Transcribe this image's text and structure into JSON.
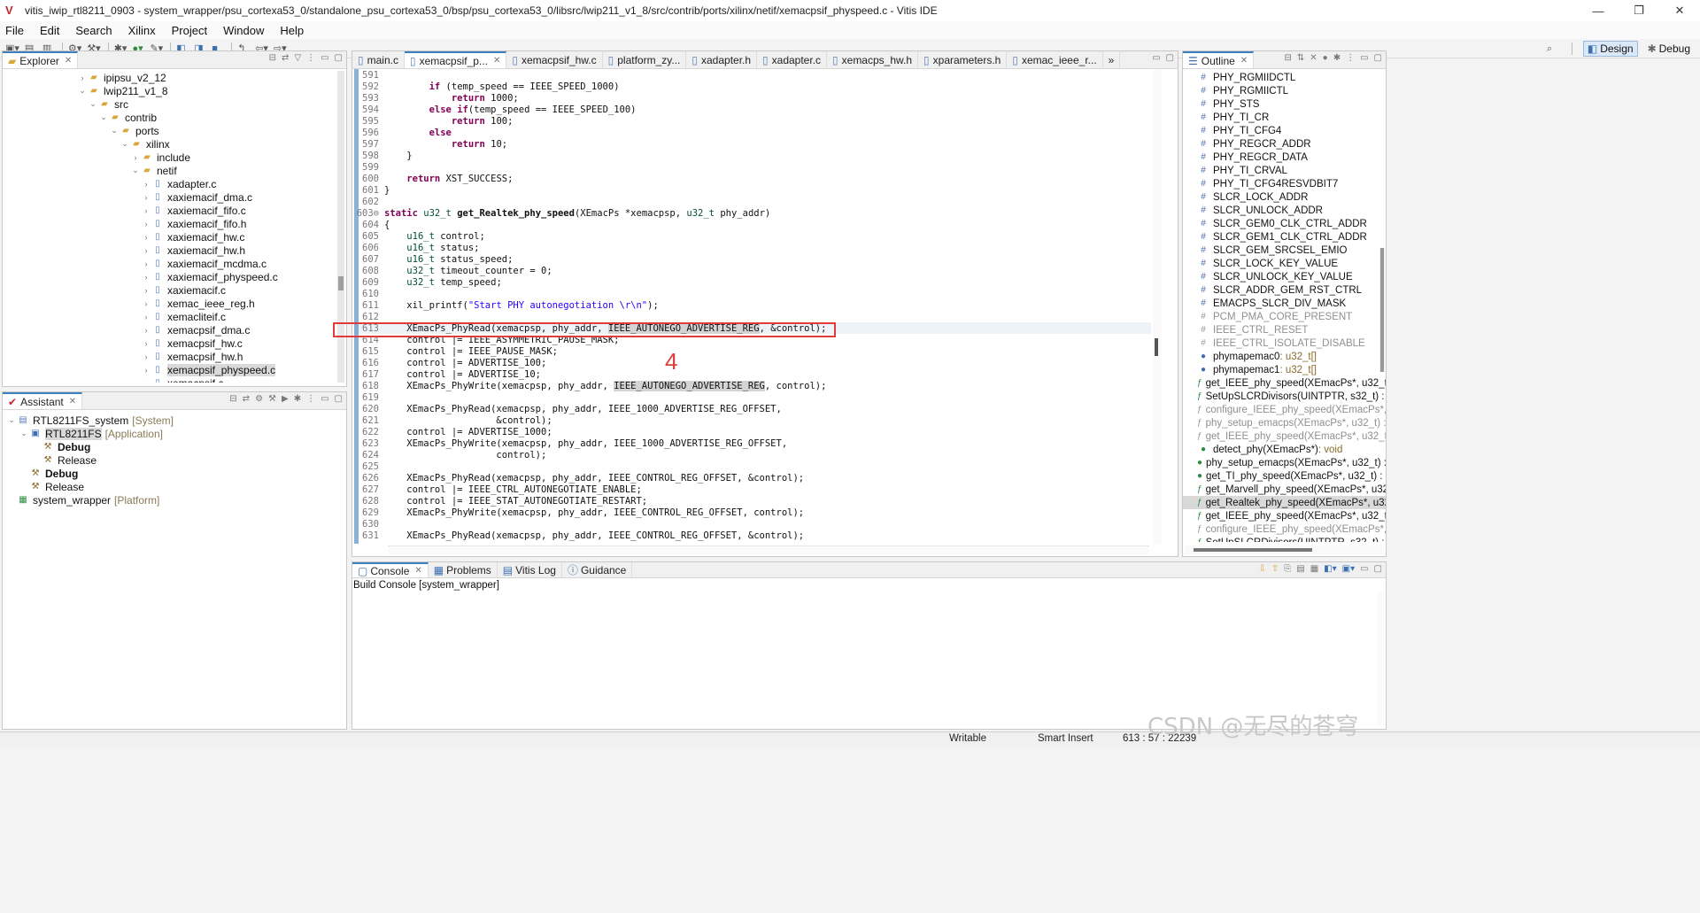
{
  "window": {
    "title": "vitis_iwip_rtl8211_0903 - system_wrapper/psu_cortexa53_0/standalone_psu_cortexa53_0/bsp/psu_cortexa53_0/libsrc/lwip211_v1_8/src/contrib/ports/xilinx/netif/xemacpsif_physpeed.c - Vitis IDE",
    "controls": [
      "—",
      "❐",
      "✕"
    ]
  },
  "menu": [
    "File",
    "Edit",
    "Search",
    "Xilinx",
    "Project",
    "Window",
    "Help"
  ],
  "perspectives": [
    {
      "label": "Design",
      "active": true
    },
    {
      "label": "Debug",
      "active": false
    }
  ],
  "explorer": {
    "tab": "Explorer",
    "items": [
      {
        "label": "ipipsu_v2_12",
        "indent": 7,
        "type": "folder",
        "twisty": "›"
      },
      {
        "label": "lwip211_v1_8",
        "indent": 7,
        "type": "folder",
        "twisty": "⌄"
      },
      {
        "label": "src",
        "indent": 8,
        "type": "folder",
        "twisty": "⌄"
      },
      {
        "label": "contrib",
        "indent": 9,
        "type": "folder",
        "twisty": "⌄"
      },
      {
        "label": "ports",
        "indent": 10,
        "type": "folder",
        "twisty": "⌄"
      },
      {
        "label": "xilinx",
        "indent": 11,
        "type": "folder",
        "twisty": "⌄"
      },
      {
        "label": "include",
        "indent": 12,
        "type": "folder",
        "twisty": "›"
      },
      {
        "label": "netif",
        "indent": 12,
        "type": "folder",
        "twisty": "⌄"
      },
      {
        "label": "xadapter.c",
        "indent": 13,
        "type": "file",
        "twisty": "›"
      },
      {
        "label": "xaxiemacif_dma.c",
        "indent": 13,
        "type": "file",
        "twisty": "›"
      },
      {
        "label": "xaxiemacif_fifo.c",
        "indent": 13,
        "type": "file",
        "twisty": "›"
      },
      {
        "label": "xaxiemacif_fifo.h",
        "indent": 13,
        "type": "file",
        "twisty": "›"
      },
      {
        "label": "xaxiemacif_hw.c",
        "indent": 13,
        "type": "file",
        "twisty": "›"
      },
      {
        "label": "xaxiemacif_hw.h",
        "indent": 13,
        "type": "file",
        "twisty": "›"
      },
      {
        "label": "xaxiemacif_mcdma.c",
        "indent": 13,
        "type": "file",
        "twisty": "›"
      },
      {
        "label": "xaxiemacif_physpeed.c",
        "indent": 13,
        "type": "file",
        "twisty": "›"
      },
      {
        "label": "xaxiemacif.c",
        "indent": 13,
        "type": "file",
        "twisty": "›"
      },
      {
        "label": "xemac_ieee_reg.h",
        "indent": 13,
        "type": "file",
        "twisty": "›"
      },
      {
        "label": "xemacliteif.c",
        "indent": 13,
        "type": "file",
        "twisty": "›"
      },
      {
        "label": "xemacpsif_dma.c",
        "indent": 13,
        "type": "file",
        "twisty": "›"
      },
      {
        "label": "xemacpsif_hw.c",
        "indent": 13,
        "type": "file",
        "twisty": "›"
      },
      {
        "label": "xemacpsif_hw.h",
        "indent": 13,
        "type": "file",
        "twisty": "›"
      },
      {
        "label": "xemacpsif_physpeed.c",
        "indent": 13,
        "type": "file",
        "twisty": "›",
        "selected": true
      },
      {
        "label": "xemacpsif.c",
        "indent": 13,
        "type": "file",
        "twisty": "›"
      }
    ]
  },
  "assistant": {
    "tab": "Assistant",
    "items": [
      {
        "label": "RTL8211FS_system",
        "suffix": "[System]",
        "indent": 0,
        "twisty": "⌄",
        "icon": "system"
      },
      {
        "label": "RTL8211FS",
        "suffix": "[Application]",
        "indent": 1,
        "twisty": "⌄",
        "icon": "app",
        "selected": true
      },
      {
        "label": "Debug",
        "suffix": "",
        "indent": 2,
        "twisty": "",
        "icon": "hammer",
        "bold": true
      },
      {
        "label": "Release",
        "suffix": "",
        "indent": 2,
        "twisty": "",
        "icon": "hammer"
      },
      {
        "label": "Debug",
        "suffix": "",
        "indent": 1,
        "twisty": "",
        "icon": "hammer",
        "bold": true
      },
      {
        "label": "Release",
        "suffix": "",
        "indent": 1,
        "twisty": "",
        "icon": "hammer"
      },
      {
        "label": "system_wrapper",
        "suffix": "[Platform]",
        "indent": 0,
        "twisty": "",
        "icon": "platform"
      }
    ]
  },
  "editor": {
    "tabs": [
      "main.c",
      "xemacpsif_p...",
      "xemacpsif_hw.c",
      "platform_zy...",
      "xadapter.h",
      "xadapter.c",
      "xemacps_hw.h",
      "xparameters.h",
      "xemac_ieee_r...",
      "»"
    ],
    "active_tab": 1,
    "lines": [
      {
        "n": "591",
        "t": ""
      },
      {
        "n": "592",
        "t": "        if (temp_speed == IEEE_SPEED_1000)"
      },
      {
        "n": "593",
        "t": "            return 1000;"
      },
      {
        "n": "594",
        "t": "        else if(temp_speed == IEEE_SPEED_100)"
      },
      {
        "n": "595",
        "t": "            return 100;"
      },
      {
        "n": "596",
        "t": "        else"
      },
      {
        "n": "597",
        "t": "            return 10;"
      },
      {
        "n": "598",
        "t": "    }"
      },
      {
        "n": "599",
        "t": ""
      },
      {
        "n": "600",
        "t": "    return XST_SUCCESS;"
      },
      {
        "n": "601",
        "t": "}"
      },
      {
        "n": "602",
        "t": ""
      },
      {
        "n": "603⊖",
        "t": "static u32_t get_Realtek_phy_speed(XEmacPs *xemacpsp, u32_t phy_addr)"
      },
      {
        "n": "604",
        "t": "{"
      },
      {
        "n": "605",
        "t": "    u16_t control;"
      },
      {
        "n": "606",
        "t": "    u16_t status;"
      },
      {
        "n": "607",
        "t": "    u16_t status_speed;"
      },
      {
        "n": "608",
        "t": "    u32_t timeout_counter = 0;"
      },
      {
        "n": "609",
        "t": "    u32_t temp_speed;"
      },
      {
        "n": "610",
        "t": ""
      },
      {
        "n": "611",
        "t": "    xil_printf(\"Start PHY autonegotiation \\r\\n\");"
      },
      {
        "n": "612",
        "t": ""
      },
      {
        "n": "613",
        "t": "    XEmacPs_PhyRead(xemacpsp, phy_addr, IEEE_AUTONEGO_ADVERTISE_REG, &control);"
      },
      {
        "n": "614",
        "t": "    control |= IEEE_ASYMMETRIC_PAUSE_MASK;"
      },
      {
        "n": "615",
        "t": "    control |= IEEE_PAUSE_MASK;"
      },
      {
        "n": "616",
        "t": "    control |= ADVERTISE_100;"
      },
      {
        "n": "617",
        "t": "    control |= ADVERTISE_10;"
      },
      {
        "n": "618",
        "t": "    XEmacPs_PhyWrite(xemacpsp, phy_addr, IEEE_AUTONEGO_ADVERTISE_REG, control);"
      },
      {
        "n": "619",
        "t": ""
      },
      {
        "n": "620",
        "t": "    XEmacPs_PhyRead(xemacpsp, phy_addr, IEEE_1000_ADVERTISE_REG_OFFSET,"
      },
      {
        "n": "621",
        "t": "                    &control);"
      },
      {
        "n": "622",
        "t": "    control |= ADVERTISE_1000;"
      },
      {
        "n": "623",
        "t": "    XEmacPs_PhyWrite(xemacpsp, phy_addr, IEEE_1000_ADVERTISE_REG_OFFSET,"
      },
      {
        "n": "624",
        "t": "                    control);"
      },
      {
        "n": "625",
        "t": ""
      },
      {
        "n": "626",
        "t": "    XEmacPs_PhyRead(xemacpsp, phy_addr, IEEE_CONTROL_REG_OFFSET, &control);"
      },
      {
        "n": "627",
        "t": "    control |= IEEE_CTRL_AUTONEGOTIATE_ENABLE;"
      },
      {
        "n": "628",
        "t": "    control |= IEEE_STAT_AUTONEGOTIATE_RESTART;"
      },
      {
        "n": "629",
        "t": "    XEmacPs_PhyWrite(xemacpsp, phy_addr, IEEE_CONTROL_REG_OFFSET, control);"
      },
      {
        "n": "630",
        "t": ""
      },
      {
        "n": "631",
        "t": "    XEmacPs_PhyRead(xemacpsp, phy_addr, IEEE_CONTROL_REG_OFFSET, &control);"
      }
    ],
    "annotation_number": "4"
  },
  "outline": {
    "tab": "Outline",
    "items": [
      {
        "label": "PHY_RGMIIDCTL",
        "icon": "#",
        "dim": false
      },
      {
        "label": "PHY_RGMIICTL",
        "icon": "#",
        "dim": false
      },
      {
        "label": "PHY_STS",
        "icon": "#",
        "dim": false
      },
      {
        "label": "PHY_TI_CR",
        "icon": "#",
        "dim": false
      },
      {
        "label": "PHY_TI_CFG4",
        "icon": "#",
        "dim": false
      },
      {
        "label": "PHY_REGCR_ADDR",
        "icon": "#",
        "dim": false
      },
      {
        "label": "PHY_REGCR_DATA",
        "icon": "#",
        "dim": false
      },
      {
        "label": "PHY_TI_CRVAL",
        "icon": "#",
        "dim": false
      },
      {
        "label": "PHY_TI_CFG4RESVDBIT7",
        "icon": "#",
        "dim": false
      },
      {
        "label": "SLCR_LOCK_ADDR",
        "icon": "#",
        "dim": false
      },
      {
        "label": "SLCR_UNLOCK_ADDR",
        "icon": "#",
        "dim": false
      },
      {
        "label": "SLCR_GEM0_CLK_CTRL_ADDR",
        "icon": "#",
        "dim": false
      },
      {
        "label": "SLCR_GEM1_CLK_CTRL_ADDR",
        "icon": "#",
        "dim": false
      },
      {
        "label": "SLCR_GEM_SRCSEL_EMIO",
        "icon": "#",
        "dim": false
      },
      {
        "label": "SLCR_LOCK_KEY_VALUE",
        "icon": "#",
        "dim": false
      },
      {
        "label": "SLCR_UNLOCK_KEY_VALUE",
        "icon": "#",
        "dim": false
      },
      {
        "label": "SLCR_ADDR_GEM_RST_CTRL",
        "icon": "#",
        "dim": false
      },
      {
        "label": "EMACPS_SLCR_DIV_MASK",
        "icon": "#",
        "dim": false
      },
      {
        "label": "PCM_PMA_CORE_PRESENT",
        "icon": "#",
        "dim": true
      },
      {
        "label": "IEEE_CTRL_RESET",
        "icon": "#",
        "dim": true
      },
      {
        "label": "IEEE_CTRL_ISOLATE_DISABLE",
        "icon": "#",
        "dim": true
      },
      {
        "label": "phymapemac0",
        "type": " : u32_t[]",
        "icon": "●",
        "dim": false
      },
      {
        "label": "phymapemac1",
        "type": " : u32_t[]",
        "icon": "●",
        "dim": false
      },
      {
        "label": "get_IEEE_phy_speed(XEmacPs*, u32_t)",
        "icon": "ƒ",
        "dim": false
      },
      {
        "label": "SetUpSLCRDivisors(UINTPTR, s32_t) : v",
        "icon": "ƒ",
        "dim": false
      },
      {
        "label": "configure_IEEE_phy_speed(XEmacPs*, u",
        "icon": "ƒ",
        "dim": true
      },
      {
        "label": "phy_setup_emacps(XEmacPs*, u32_t) :",
        "icon": "ƒ",
        "dim": true
      },
      {
        "label": "get_IEEE_phy_speed(XEmacPs*, u32_t)",
        "icon": "ƒ",
        "dim": true
      },
      {
        "label": "detect_phy(XEmacPs*)",
        "type": " : void",
        "icon": "●",
        "dim": false
      },
      {
        "label": "phy_setup_emacps(XEmacPs*, u32_t) :",
        "icon": "●",
        "dim": false
      },
      {
        "label": "get_TI_phy_speed(XEmacPs*, u32_t) : u",
        "icon": "●",
        "dim": false
      },
      {
        "label": "get_Marvell_phy_speed(XEmacPs*, u32",
        "icon": "ƒ",
        "dim": false
      },
      {
        "label": "get_Realtek_phy_speed(XEmacPs*, u32",
        "icon": "ƒ",
        "dim": false,
        "selected": true
      },
      {
        "label": "get_IEEE_phy_speed(XEmacPs*, u32_t)",
        "icon": "ƒ",
        "dim": false
      },
      {
        "label": "configure_IEEE_phy_speed(XEmacPs*, u",
        "icon": "ƒ",
        "dim": true
      },
      {
        "label": "SetUpSLCRDivisors(UINTPTR, s32_t) : v",
        "icon": "ƒ",
        "dim": false
      }
    ]
  },
  "console": {
    "tabs": [
      {
        "label": "Console",
        "icon": "▢",
        "active": true
      },
      {
        "label": "Problems",
        "icon": "▦",
        "active": false
      },
      {
        "label": "Vitis Log",
        "icon": "▤",
        "active": false
      },
      {
        "label": "Guidance",
        "icon": "ⓘ",
        "active": false
      }
    ],
    "header": "Build Console [system_wrapper]"
  },
  "status": {
    "writable": "Writable",
    "insert_mode": "Smart Insert",
    "position": "613 : 57 : 22239"
  },
  "watermark": "CSDN @无尽的苍穹"
}
